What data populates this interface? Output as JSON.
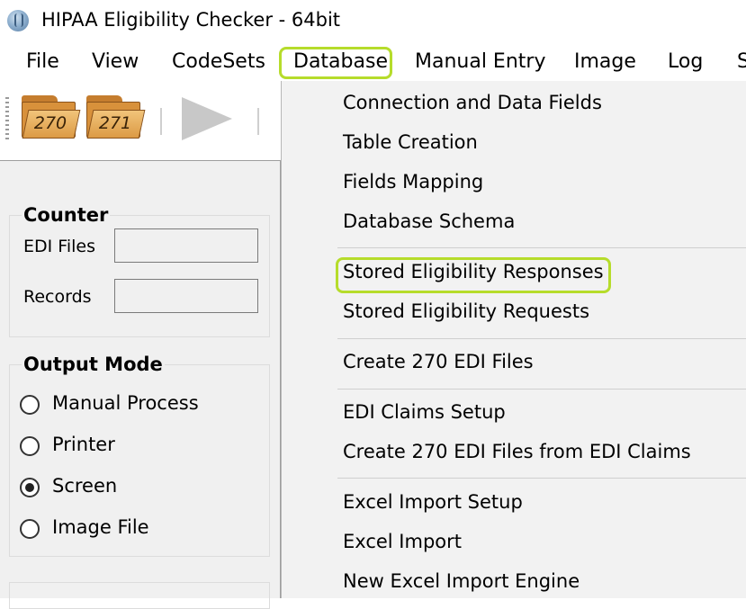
{
  "window": {
    "title": "HIPAA Eligibility Checker - 64bit"
  },
  "menubar": {
    "items": [
      "File",
      "View",
      "CodeSets",
      "Database",
      "Manual Entry",
      "Image",
      "Log",
      "S"
    ]
  },
  "toolbar": {
    "btn270_label": "270",
    "btn271_label": "271"
  },
  "counter": {
    "title": "Counter",
    "edi_files_label": "EDI Files",
    "edi_files_value": "",
    "records_label": "Records",
    "records_value": ""
  },
  "output_mode": {
    "title": "Output Mode",
    "options": [
      "Manual Process",
      "Printer",
      "Screen",
      "Image File"
    ],
    "selected": "Screen"
  },
  "database_menu": {
    "items": [
      "Connection and Data Fields",
      "Table Creation",
      "Fields Mapping",
      "Database Schema",
      "Stored Eligibility Responses",
      "Stored Eligibility Requests",
      "Create 270 EDI Files",
      "EDI Claims Setup",
      "Create 270 EDI Files from EDI Claims",
      "Excel Import Setup",
      "Excel Import",
      "New Excel Import Engine"
    ],
    "highlighted": "Stored Eligibility Responses"
  },
  "colors": {
    "highlight": "#b6dc2b",
    "menu_bg": "#f2f2f2",
    "panel_bg": "#f0f0f0"
  }
}
